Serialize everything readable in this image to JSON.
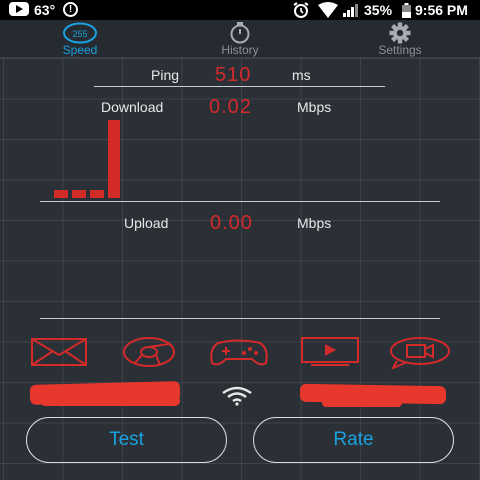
{
  "status_bar": {
    "temperature": "63°",
    "battery": "35%",
    "time": "9:56 PM"
  },
  "tabs": [
    {
      "label": "Speed",
      "icon": "speedometer-icon",
      "active": true,
      "badge": "255"
    },
    {
      "label": "History",
      "icon": "stopwatch-icon",
      "active": false
    },
    {
      "label": "Settings",
      "icon": "gear-icon",
      "active": false
    }
  ],
  "ping": {
    "label": "Ping",
    "value": "510",
    "unit": "ms"
  },
  "download": {
    "label": "Download",
    "value": "0.02",
    "unit": "Mbps"
  },
  "upload": {
    "label": "Upload",
    "value": "0.00",
    "unit": "Mbps"
  },
  "download_history": [
    0.002,
    0.002,
    0.002,
    0.02
  ],
  "app_icons": [
    "mail-icon",
    "chrome-icon",
    "gamepad-icon",
    "video-player-icon",
    "video-call-icon"
  ],
  "buttons": {
    "test": "Test",
    "rate": "Rate"
  },
  "colors": {
    "accent": "#1aa2e0",
    "value": "#d32a2a",
    "background": "#2b2f36"
  }
}
